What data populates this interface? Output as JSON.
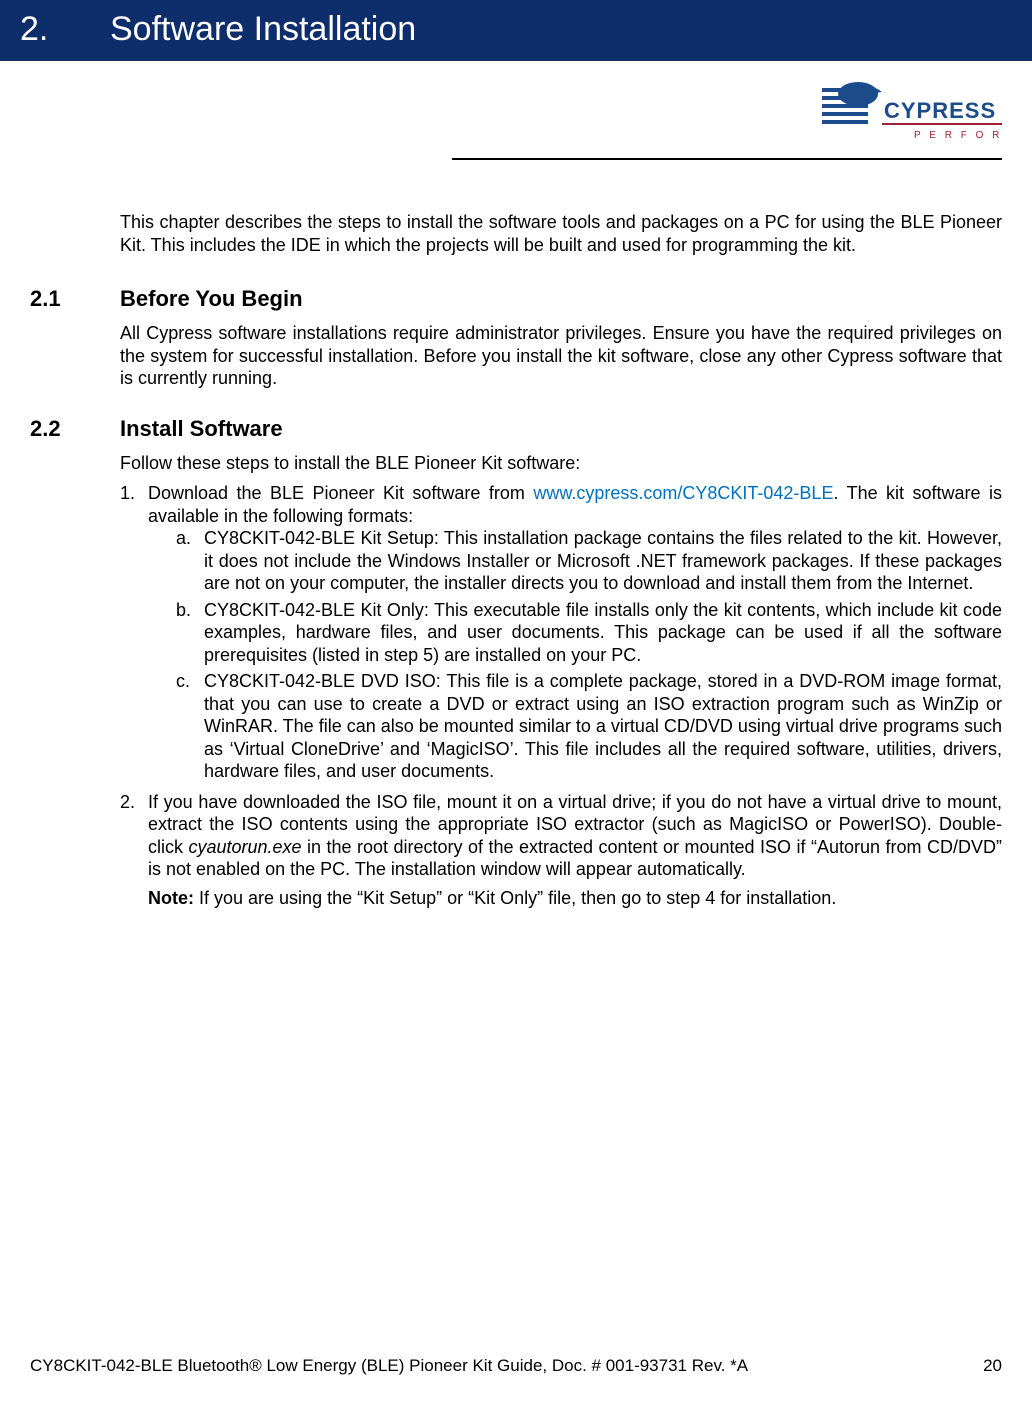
{
  "chapter": {
    "number": "2.",
    "title": "Software Installation"
  },
  "logo": {
    "brand": "CYPRESS",
    "tagline": "P E R F O R M"
  },
  "intro": "This chapter describes the steps to install the software tools and packages on a PC for using the BLE Pioneer Kit. This includes the IDE in which the projects will be built and used for programming the kit.",
  "sections": {
    "s1": {
      "num": "2.1",
      "title": "Before You Begin",
      "body": "All Cypress software installations require administrator privileges. Ensure you have the required privileges on the system for successful installation. Before you install the kit software, close any other Cypress software that is currently running."
    },
    "s2": {
      "num": "2.2",
      "title": "Install Software",
      "lead": "Follow these steps to install the BLE Pioneer Kit software:",
      "step1_pre": "Download the BLE Pioneer Kit software from ",
      "step1_link": "www.cypress.com/CY8CKIT-042-BLE",
      "step1_post": ". The kit software is available in the following formats:",
      "step1a": "CY8CKIT-042-BLE Kit Setup: This installation package contains the files related to the kit. However, it does not include the Windows Installer or Microsoft .NET framework packages. If these packages are not on your computer, the installer directs you to download and install them from the Internet.",
      "step1b": "CY8CKIT-042-BLE Kit Only: This executable file installs only the kit contents, which include kit code examples, hardware files, and user documents. This package can be used if all the software prerequisites (listed in step 5) are installed on your PC.",
      "step1c": "CY8CKIT-042-BLE DVD ISO: This file is a complete package, stored in a DVD-ROM image format, that you can use to create a DVD or extract using an ISO extraction program such as WinZip or WinRAR. The file can also be mounted similar to a virtual CD/DVD using virtual drive programs such as ‘Virtual CloneDrive’ and ‘MagicISO’. This file includes all the required software, utilities, drivers, hardware files, and user documents.",
      "step2_pre": "If you have downloaded the ISO file, mount it on a virtual drive; if you do not have a virtual drive to mount, extract the ISO contents using the appropriate ISO extractor (such as MagicISO or PowerISO). Double-click ",
      "step2_em": "cyautorun.exe",
      "step2_post": " in the root directory of the extracted content or mounted ISO if “Autorun from CD/DVD” is not enabled on the PC. The installation window will appear automatically.",
      "note_label": "Note:",
      "note_text": " If you are using the “Kit Setup” or “Kit Only” file, then go to step 4 for installation.",
      "markers": {
        "n1": "1.",
        "n2": "2.",
        "a": "a.",
        "b": "b.",
        "c": "c."
      }
    }
  },
  "footer": {
    "doc": "CY8CKIT-042-BLE Bluetooth® Low Energy (BLE) Pioneer Kit Guide, Doc. # 001-93731 Rev. *A",
    "page": "20"
  }
}
